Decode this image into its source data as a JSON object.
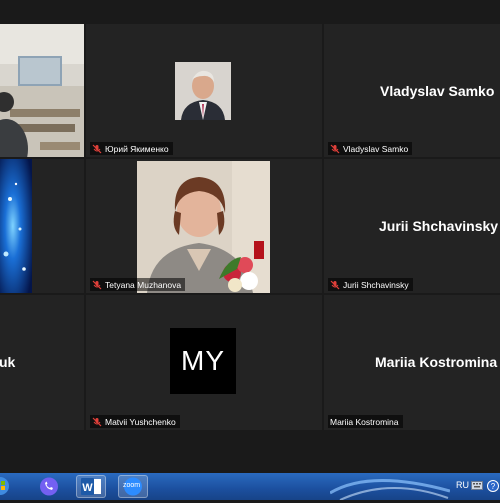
{
  "participants": [
    {
      "id": "self",
      "name": "",
      "muted": false
    },
    {
      "id": "yuri",
      "name": "Юрий Якименко",
      "muted": true
    },
    {
      "id": "samko",
      "name": "Vladyslav Samko",
      "big_name": "Vladyslav Samko",
      "muted": true
    },
    {
      "id": "blue",
      "name": "",
      "muted": false
    },
    {
      "id": "tetyana",
      "name": "Tetyana Muzhanova",
      "muted": true
    },
    {
      "id": "jurii",
      "name": "Jurii Shchavinsky",
      "big_name": "Jurii Shchavinsky",
      "muted": true
    },
    {
      "id": "uk",
      "name": "",
      "big_name": "uk",
      "muted": false
    },
    {
      "id": "matvii",
      "name": "Matvii Yushchenko",
      "initials": "MY",
      "muted": true
    },
    {
      "id": "mariia",
      "name": "Mariia Kostromina",
      "big_name": "Mariia Kostromina",
      "muted": false
    }
  ],
  "taskbar": {
    "apps": [
      "start-button",
      "viber-app",
      "word-app",
      "zoom-app"
    ],
    "zoom_label": "zoom",
    "language": "RU"
  },
  "colors": {
    "active_speaker_border": "#c6d63a",
    "mute_icon": "#e0403a",
    "taskbar": "#1f57a8"
  }
}
